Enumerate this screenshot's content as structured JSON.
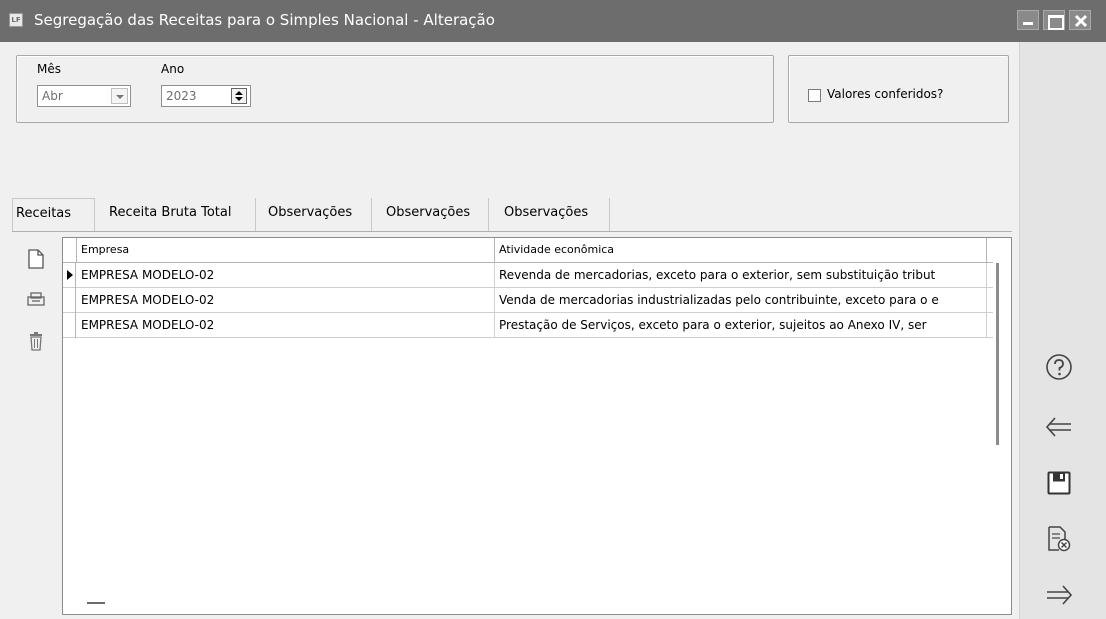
{
  "window": {
    "title": "Segregação das Receitas para o Simples Nacional - Alteração",
    "app_icon": "app-icon"
  },
  "header": {
    "mes_label": "Mês",
    "mes_value": "Abr",
    "ano_label": "Ano",
    "ano_value": "2023",
    "checkbox_label": "Valores conferidos?",
    "checkbox_checked": false
  },
  "tabs": [
    {
      "label": "Receitas",
      "active": true
    },
    {
      "label": "Receita Bruta Total",
      "active": false
    },
    {
      "label": "Observações",
      "active": false
    },
    {
      "label": "Observações",
      "active": false
    },
    {
      "label": "Observações",
      "active": false
    }
  ],
  "grid": {
    "columns": [
      "Empresa",
      "Atividade econômica"
    ],
    "rows": [
      {
        "empresa": "EMPRESA MODELO-02",
        "atividade": "Revenda de mercadorias, exceto para o exterior, sem substituição tribut",
        "current": true
      },
      {
        "empresa": "EMPRESA MODELO-02",
        "atividade": "Venda de mercadorias industrializadas pelo contribuinte, exceto para o e",
        "current": false
      },
      {
        "empresa": "EMPRESA MODELO-02",
        "atividade": "Prestação de Serviços, exceto para o exterior, sujeitos ao Anexo IV, ser",
        "current": false
      }
    ]
  },
  "left_toolbar": [
    "new-document-icon",
    "open-tray-icon",
    "trash-icon"
  ],
  "right_toolbar": [
    "help-icon",
    "back-arrow-icon",
    "save-icon",
    "cancel-document-icon",
    "forward-arrow-icon"
  ],
  "colors": {
    "titlebar": "#6d6d6d",
    "window_bg": "#f0f0f0",
    "side_panel": "#e4e4e4"
  }
}
